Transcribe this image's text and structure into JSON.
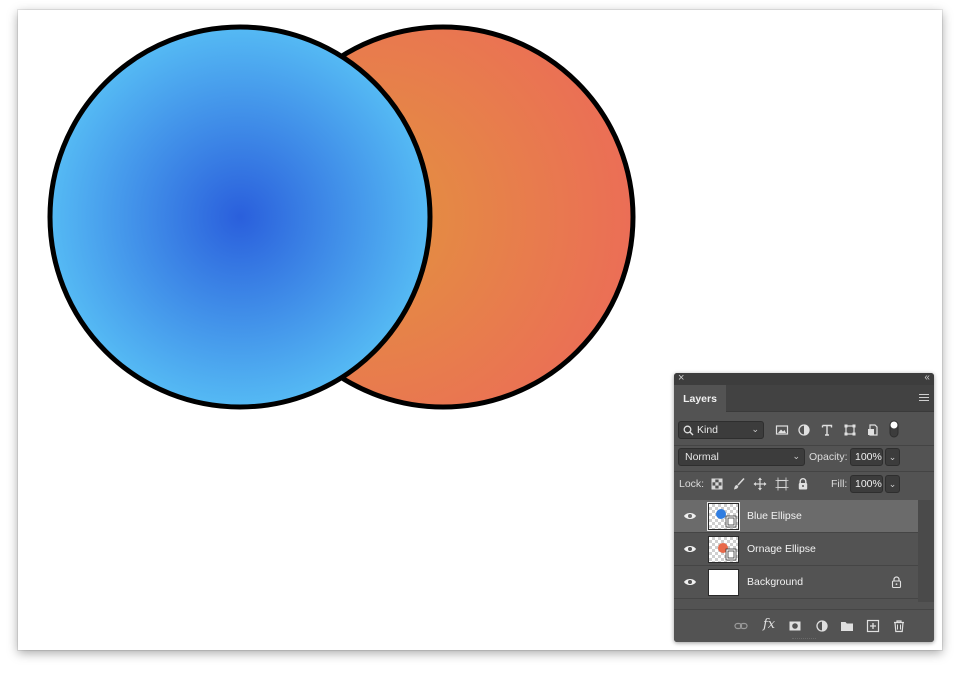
{
  "panel": {
    "close_glyph": "×",
    "collapse_glyph": "‹‹",
    "tab_label": "Layers",
    "menu_icon": "panel-menu-icon"
  },
  "filter": {
    "kind_label": "Kind",
    "icons": [
      "search-icon",
      "pixel-layer-filter-icon",
      "adjustment-layer-filter-icon",
      "type-layer-filter-icon",
      "shape-layer-filter-icon",
      "smart-object-filter-icon",
      "filter-toggle-icon"
    ]
  },
  "blend": {
    "mode": "Normal",
    "opacity_label": "Opacity:",
    "opacity_value": "100%"
  },
  "lock": {
    "label": "Lock:",
    "fill_label": "Fill:",
    "fill_value": "100%",
    "icons": [
      "lock-transparent-pixels-icon",
      "lock-image-pixels-icon",
      "lock-position-icon",
      "lock-artboard-icon",
      "lock-all-icon"
    ]
  },
  "layers": [
    {
      "name": "Blue Ellipse",
      "selected": true,
      "visible": true,
      "thumb": "checker",
      "badge_color": "#2f7de1"
    },
    {
      "name": "Ornage Ellipse",
      "selected": false,
      "visible": true,
      "thumb": "checker",
      "badge_color": "#e8694a"
    },
    {
      "name": "Background",
      "selected": false,
      "visible": true,
      "thumb": "white",
      "locked": true
    }
  ],
  "bottom_icons": [
    "link-layers-icon",
    "fx-icon",
    "add-mask-icon",
    "adjustment-layer-icon",
    "new-group-icon",
    "new-layer-icon",
    "trash-icon"
  ],
  "bottom_fx_label": "fx",
  "colors": {
    "blue_center": "#2a5fdc",
    "blue_edge": "#55baf4",
    "orange_center": "#e2933e",
    "orange_edge": "#ec6b58",
    "stroke": "#000000",
    "panel_bg": "#535353",
    "selected_row": "#6b6b6b"
  }
}
